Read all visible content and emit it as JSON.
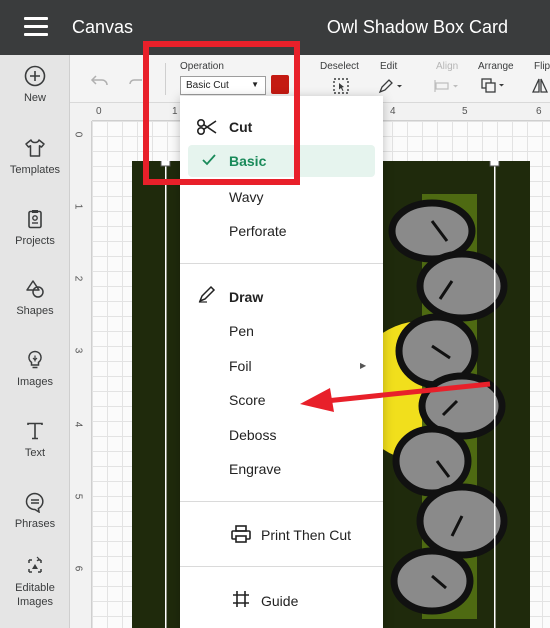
{
  "app": {
    "title": "Canvas",
    "document_title": "Owl Shadow Box Card"
  },
  "sidebar": {
    "items": [
      {
        "label": "New",
        "icon": "plus-circle-icon"
      },
      {
        "label": "Templates",
        "icon": "shirt-icon"
      },
      {
        "label": "Projects",
        "icon": "clipboard-icon"
      },
      {
        "label": "Shapes",
        "icon": "shapes-icon"
      },
      {
        "label": "Images",
        "icon": "lightbulb-icon"
      },
      {
        "label": "Text",
        "icon": "text-icon"
      },
      {
        "label": "Phrases",
        "icon": "speech-bubble-icon"
      },
      {
        "label": "Editable",
        "label2": "Images",
        "icon": "editable-images-icon"
      }
    ]
  },
  "toolbar": {
    "operation_label": "Operation",
    "operation_value": "Basic Cut",
    "operation_color": "#c41a12",
    "deselect_label": "Deselect",
    "edit_label": "Edit",
    "align_label": "Align",
    "arrange_label": "Arrange",
    "flip_label": "Flip"
  },
  "ruler": {
    "top": [
      "1",
      "4",
      "5",
      "6"
    ],
    "left": [
      "0",
      "1",
      "2",
      "3",
      "4",
      "5",
      "6"
    ]
  },
  "menu": {
    "cut_heading": "Cut",
    "cut_items": [
      "Basic",
      "Wavy",
      "Perforate"
    ],
    "selected_item": "Basic",
    "draw_heading": "Draw",
    "draw_items": [
      "Pen",
      "Foil",
      "Score",
      "Deboss",
      "Engrave"
    ],
    "print_then_cut": "Print Then Cut",
    "guide": "Guide"
  },
  "colors": {
    "topbar": "#3a3c3d",
    "selected_accent": "#1a8a5a",
    "highlight": "#e8202a",
    "art_dark": "#1f2a0c",
    "art_green": "#4e6a12",
    "art_yellow": "#f1df1c",
    "art_gray": "#8a8a8a"
  }
}
